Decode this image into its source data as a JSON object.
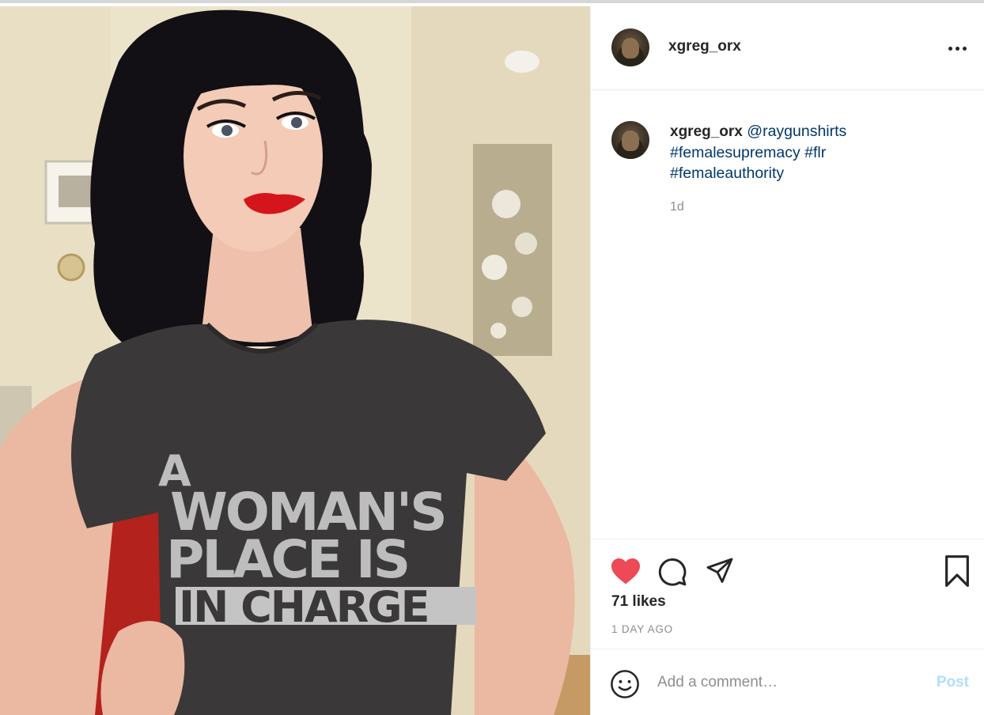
{
  "post": {
    "image": {
      "shirt_text_lines": [
        "A",
        "WOMAN'S",
        "PLACE IS",
        "IN CHARGE"
      ]
    },
    "header": {
      "username": "xgreg_orx",
      "avatar_icon": "profile-avatar",
      "more_icon": "more-options-icon"
    },
    "caption": {
      "username": "xgreg_orx",
      "mention": "@raygunshirts",
      "hashtags": [
        "#femalesupremacy",
        "#flr",
        "#femaleauthority"
      ],
      "time_ago": "1d"
    },
    "actions": {
      "like_icon": "heart-icon",
      "liked": true,
      "comment_icon": "comment-icon",
      "share_icon": "share-icon",
      "save_icon": "bookmark-icon",
      "likes_text": "71 likes",
      "date_text": "1 DAY AGO"
    },
    "comment_box": {
      "emoji_icon": "emoji-icon",
      "placeholder": "Add a comment…",
      "post_label": "Post"
    }
  },
  "colors": {
    "like_red": "#ed4956",
    "link_blue": "#00376b",
    "post_disabled": "#b2dffc",
    "secondary_text": "#8e8e8e"
  }
}
